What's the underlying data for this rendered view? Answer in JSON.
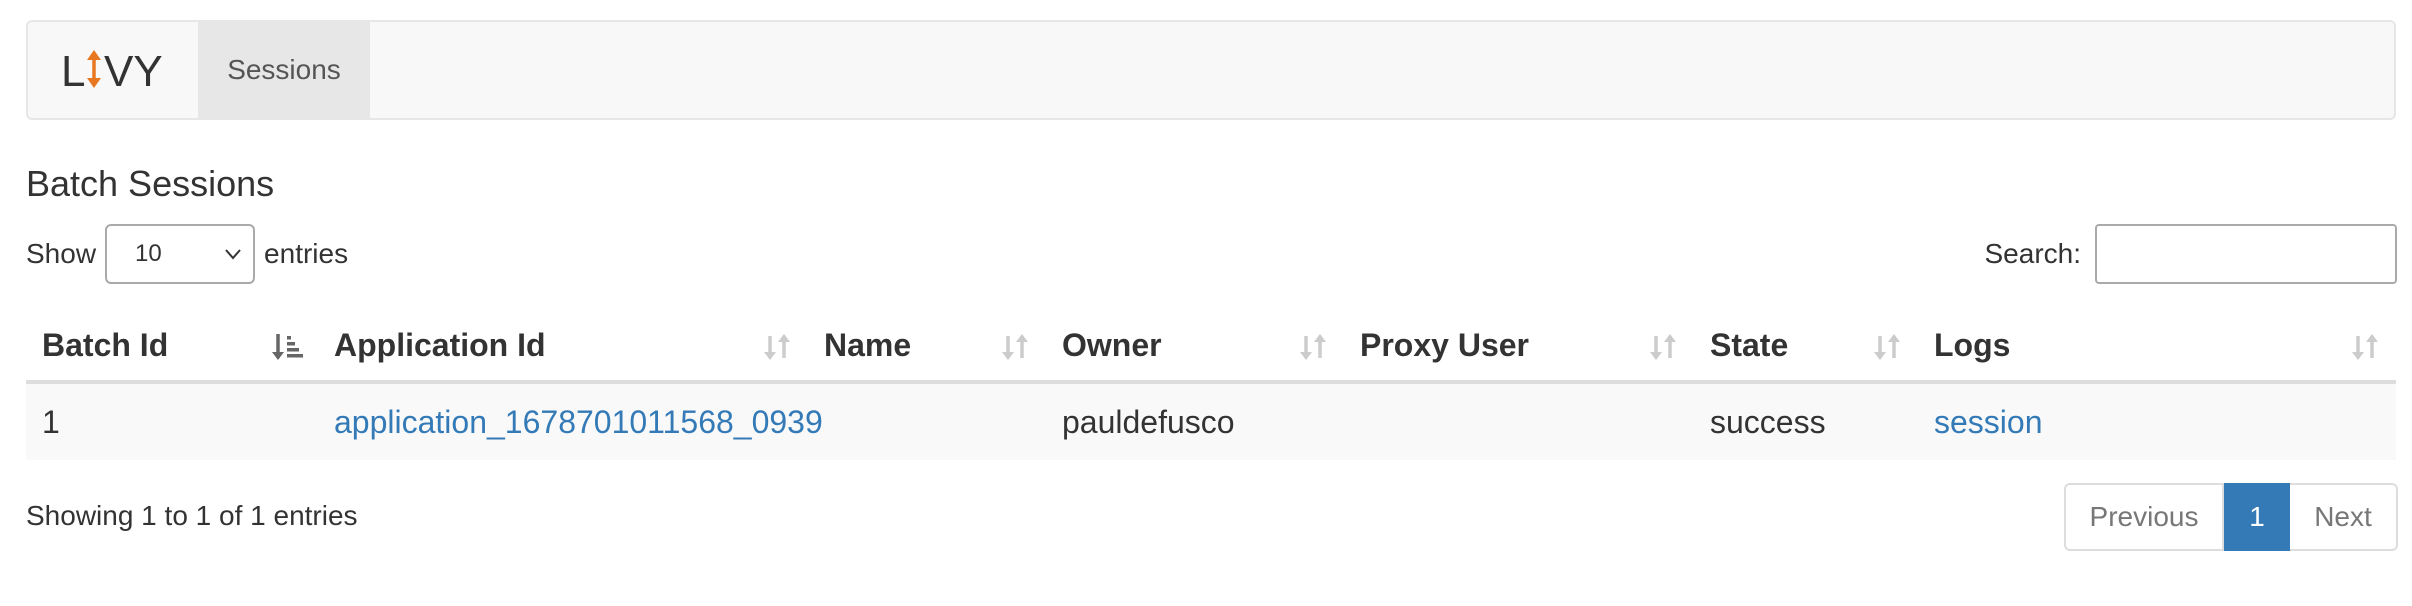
{
  "navbar": {
    "brand_name": "LIVY",
    "nav_items": [
      {
        "label": "Sessions"
      }
    ],
    "colors": {
      "brand_text": "#333333",
      "brand_accent": "#e87722",
      "active_bg": "#e7e7e7"
    }
  },
  "page": {
    "title": "Batch Sessions"
  },
  "length_control": {
    "prefix": "Show",
    "selected": "10",
    "suffix": "entries"
  },
  "search": {
    "label": "Search:",
    "value": "",
    "placeholder": ""
  },
  "table": {
    "columns": [
      {
        "label": "Batch Id",
        "sort": "ascending",
        "icon": "sort-ascending-icon"
      },
      {
        "label": "Application Id",
        "sort": "none",
        "icon": "sort-both-icon"
      },
      {
        "label": "Name",
        "sort": "none",
        "icon": "sort-both-icon"
      },
      {
        "label": "Owner",
        "sort": "none",
        "icon": "sort-both-icon"
      },
      {
        "label": "Proxy User",
        "sort": "none",
        "icon": "sort-both-icon"
      },
      {
        "label": "State",
        "sort": "none",
        "icon": "sort-both-icon"
      },
      {
        "label": "Logs",
        "sort": "none",
        "icon": "sort-both-icon"
      }
    ],
    "rows": [
      {
        "batch_id": "1",
        "application_id": "application_1678701011568_0939",
        "name": "",
        "owner": "pauldefusco",
        "proxy_user": "",
        "state": "success",
        "logs": "session"
      }
    ],
    "colors": {
      "link": "#337ab7",
      "row_bg": "#f9f9f9"
    }
  },
  "info": {
    "text": "Showing 1 to 1 of 1 entries"
  },
  "pagination": {
    "previous": "Previous",
    "current": "1",
    "next": "Next",
    "colors": {
      "active": "#337ab7"
    }
  }
}
